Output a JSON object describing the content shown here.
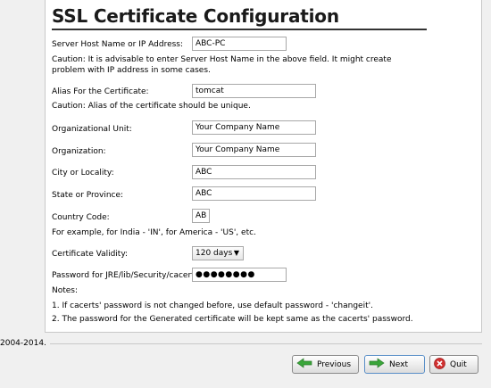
{
  "title": "SSL Certificate Configuration",
  "host": {
    "label": "Server Host Name or IP Address:",
    "value": "ABC-PC",
    "caution": "Caution: It is advisable to enter Server Host Name in the above field. It might create problem with IP address in some cases."
  },
  "alias": {
    "label": "Alias For the Certificate:",
    "value": "tomcat",
    "caution": "Caution: Alias of the certificate should be unique."
  },
  "org_unit": {
    "label": "Organizational Unit:",
    "value": "Your Company Name"
  },
  "org": {
    "label": "Organization:",
    "value": "Your Company Name"
  },
  "city": {
    "label": "City or Locality:",
    "value": "ABC"
  },
  "state": {
    "label": "State or Province:",
    "value": "ABC"
  },
  "country": {
    "label": "Country Code:",
    "value": "AB",
    "example": "For example, for India - 'IN', for America - 'US', etc."
  },
  "validity": {
    "label": "Certificate Validity:",
    "value": "120 days"
  },
  "password": {
    "label": "Password for JRE/lib/Security/cacerts:",
    "value": "●●●●●●●●"
  },
  "notes": {
    "heading": "Notes:",
    "items": [
      "1. If cacerts' password is not changed before, use default password - 'changeit'.",
      "2. The password for the Generated certificate will be kept same as the cacerts' password."
    ]
  },
  "footer": {
    "copyright": "2004-2014."
  },
  "buttons": {
    "previous": "Previous",
    "next": "Next",
    "quit": "Quit"
  },
  "colors": {
    "arrow_green": "#3aa63a",
    "quit_red": "#d03030"
  }
}
